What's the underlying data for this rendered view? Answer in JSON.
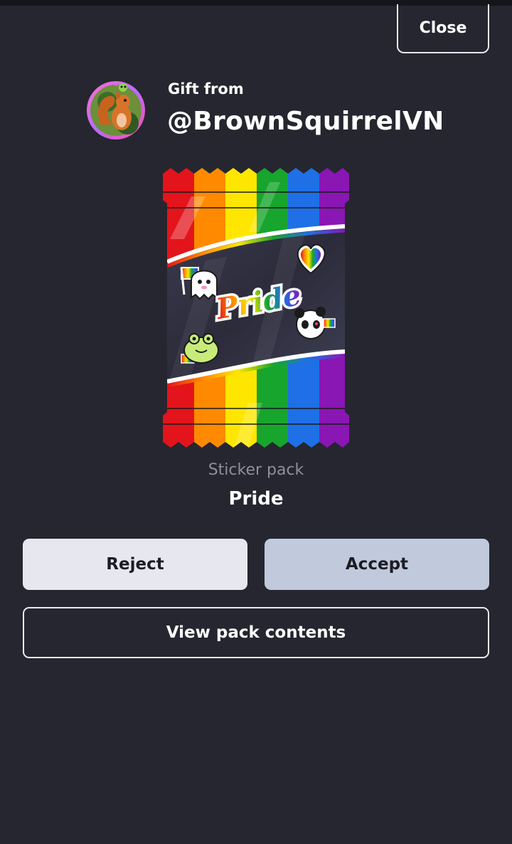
{
  "header": {
    "close_label": "Close"
  },
  "gift": {
    "from_label": "Gift from",
    "sender": "@BrownSquirrelVN",
    "avatar_icon": "squirrel-avatar-icon"
  },
  "pack": {
    "type_label": "Sticker pack",
    "name": "Pride",
    "wrapper_text": "Pride",
    "stripe_colors": [
      "#e3141b",
      "#ff8a00",
      "#ffe600",
      "#18a52e",
      "#1f6fe6",
      "#8a16b3"
    ]
  },
  "actions": {
    "reject_label": "Reject",
    "accept_label": "Accept",
    "view_label": "View pack contents"
  }
}
